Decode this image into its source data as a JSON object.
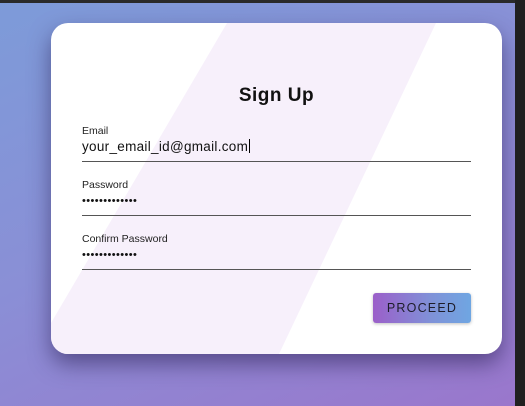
{
  "form": {
    "title": "Sign Up",
    "email": {
      "label": "Email",
      "value": "your_email_id@gmail.com"
    },
    "password": {
      "label": "Password",
      "masked_value": "•••••••••••••"
    },
    "confirm_password": {
      "label": "Confirm Password",
      "masked_value": "•••••••••••••"
    },
    "proceed_label": "PROCEED"
  },
  "colors": {
    "background_start": "#7d9bd9",
    "background_end": "#9a76cc",
    "card": "#ffffff",
    "button_start": "#9b5fc9",
    "button_end": "#6fa6e2"
  }
}
